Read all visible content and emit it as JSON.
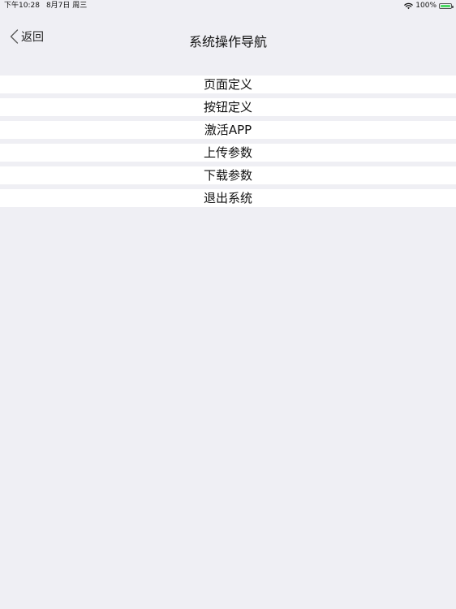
{
  "status_bar": {
    "time": "下午10:28",
    "date": "8月7日 周三",
    "battery_percent": "100%",
    "wifi_icon": "wifi-icon",
    "battery_icon": "battery-charging-icon",
    "battery_color": "#4cd964"
  },
  "nav": {
    "back_label": "返回",
    "back_icon": "chevron-left-icon",
    "title": "系统操作导航"
  },
  "menu": {
    "items": [
      {
        "label": "页面定义"
      },
      {
        "label": "按钮定义"
      },
      {
        "label": "激活APP"
      },
      {
        "label": "上传参数"
      },
      {
        "label": "下载参数"
      },
      {
        "label": "退出系统"
      }
    ]
  }
}
